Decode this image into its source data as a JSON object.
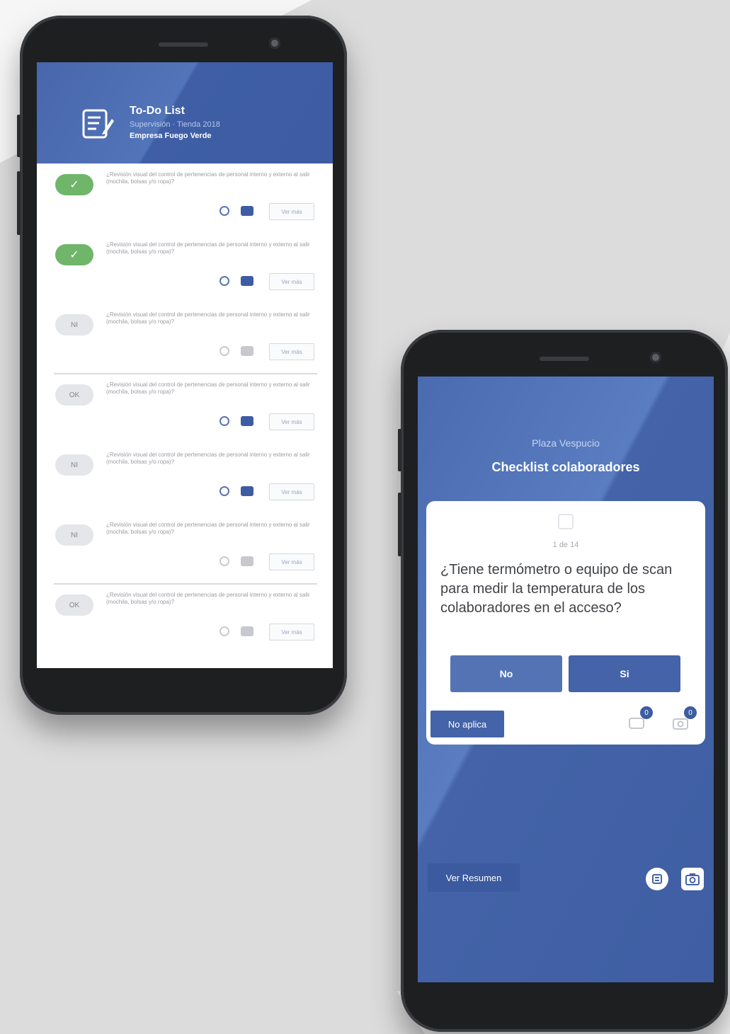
{
  "todo": {
    "title": "To-Do List",
    "subtitle": "Supervisión · Tienda 2018",
    "company": "Empresa Fuego Verde",
    "button_label": "Ver más",
    "tasks": [
      {
        "status": "done",
        "status_label": "✓",
        "text": "¿Revisión visual del control de pertenencias de personal interno y externo al salir (mochila, bolsas y/o ropa)?",
        "active": true
      },
      {
        "status": "done",
        "status_label": "✓",
        "text": "¿Revisión visual del control de pertenencias de personal interno y externo al salir (mochila, bolsas y/o ropa)?",
        "active": true
      },
      {
        "status": "pending",
        "status_label": "NI",
        "text": "¿Revisión visual del control de pertenencias de personal interno y externo al salir (mochila, bolsas y/o ropa)?",
        "active": false
      },
      {
        "status": "pending",
        "status_label": "OK",
        "text": "¿Revisión visual del control de pertenencias de personal interno y externo al salir (mochila, bolsas y/o ropa)?",
        "active": true
      },
      {
        "status": "pending",
        "status_label": "NI",
        "text": "¿Revisión visual del control de pertenencias de personal interno y externo al salir (mochila, bolsas y/o ropa)?",
        "active": true
      },
      {
        "status": "pending",
        "status_label": "NI",
        "text": "¿Revisión visual del control de pertenencias de personal interno y externo al salir (mochila, bolsas y/o ropa)?",
        "active": false
      },
      {
        "status": "pending",
        "status_label": "OK",
        "text": "¿Revisión visual del control de pertenencias de personal interno y externo al salir (mochila, bolsas y/o ropa)?",
        "active": false
      }
    ]
  },
  "checklist": {
    "place": "Plaza Vespucio",
    "title": "Checklist colaboradores",
    "counter": "1 de 14",
    "question": "¿Tiene termómetro o equipo de scan para medir la temperatura de los colaboradores en el acceso?",
    "no_label": "No",
    "si_label": "Si",
    "na_label": "No aplica",
    "badge_comments": "0",
    "badge_photos": "0",
    "resume_label": "Ver Resumen"
  },
  "colors": {
    "brand": "#4463a8",
    "success": "#6fb56a",
    "background": "#ececec"
  }
}
